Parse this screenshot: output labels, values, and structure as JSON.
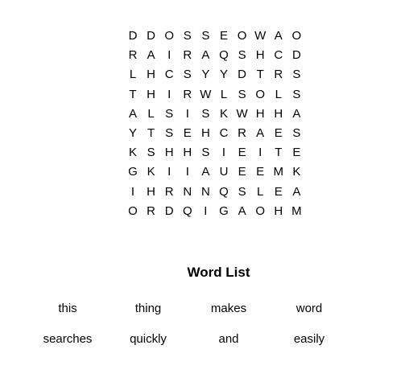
{
  "grid": [
    [
      "D",
      "D",
      "O",
      "S",
      "S",
      "E",
      "O",
      "W",
      "A",
      "O"
    ],
    [
      "R",
      "A",
      "I",
      "R",
      "A",
      "Q",
      "S",
      "H",
      "C",
      "D"
    ],
    [
      "L",
      "H",
      "C",
      "S",
      "Y",
      "Y",
      "D",
      "T",
      "R",
      "S"
    ],
    [
      "T",
      "H",
      "I",
      "R",
      "W",
      "L",
      "S",
      "O",
      "L",
      "S"
    ],
    [
      "A",
      "L",
      "S",
      "I",
      "S",
      "K",
      "W",
      "H",
      "H",
      "A"
    ],
    [
      "Y",
      "T",
      "S",
      "E",
      "H",
      "C",
      "R",
      "A",
      "E",
      "S"
    ],
    [
      "K",
      "S",
      "H",
      "H",
      "S",
      "I",
      "E",
      "I",
      "T",
      "E"
    ],
    [
      "G",
      "K",
      "I",
      "I",
      "A",
      "U",
      "E",
      "E",
      "M",
      "K"
    ],
    [
      "I",
      "H",
      "R",
      "N",
      "N",
      "Q",
      "S",
      "L",
      "E",
      "A"
    ],
    [
      "O",
      "R",
      "D",
      "Q",
      "I",
      "G",
      "A",
      "O",
      "H",
      "M"
    ]
  ],
  "word_list": {
    "title": "Word List",
    "words": [
      "this",
      "thing",
      "makes",
      "word",
      "searches",
      "quickly",
      "and",
      "easily"
    ]
  }
}
